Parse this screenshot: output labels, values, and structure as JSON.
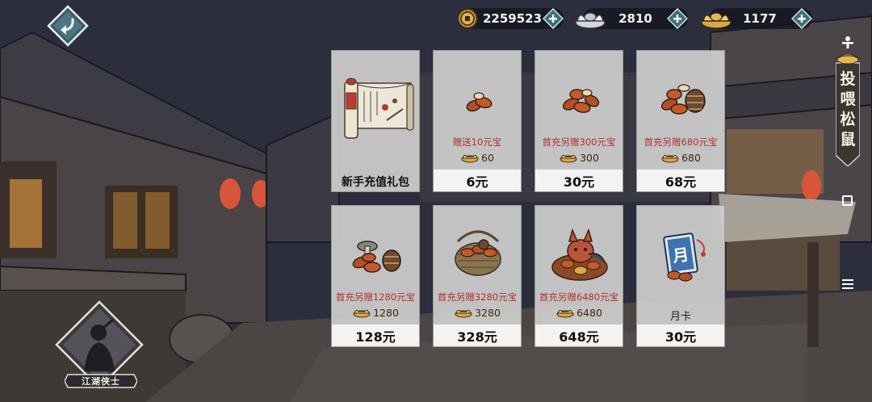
{
  "currencies": [
    {
      "name": "copper-coin",
      "amount": "2259523"
    },
    {
      "name": "silver-ingot",
      "amount": "2810"
    },
    {
      "name": "gold-ingot",
      "amount": "1177"
    }
  ],
  "side_banner": {
    "text": "投喂松鼠"
  },
  "player": {
    "title": "江湖侠士"
  },
  "shop": {
    "items": [
      {
        "id": "starter-pack",
        "title": "新手充值礼包",
        "bonus": "",
        "gold": "",
        "price": ""
      },
      {
        "id": "tier-6",
        "title": "",
        "bonus": "赠送10元宝",
        "gold": "60",
        "price": "6元"
      },
      {
        "id": "tier-30",
        "title": "",
        "bonus": "首充另赠300元宝",
        "gold": "300",
        "price": "30元"
      },
      {
        "id": "tier-68",
        "title": "",
        "bonus": "首充另赠680元宝",
        "gold": "680",
        "price": "68元"
      },
      {
        "id": "tier-128",
        "title": "",
        "bonus": "首充另赠1280元宝",
        "gold": "1280",
        "price": "128元"
      },
      {
        "id": "tier-328",
        "title": "",
        "bonus": "首充另赠3280元宝",
        "gold": "3280",
        "price": "328元"
      },
      {
        "id": "tier-648",
        "title": "",
        "bonus": "首充另赠6480元宝",
        "gold": "6480",
        "price": "648元"
      },
      {
        "id": "monthly-card",
        "title": "月卡",
        "bonus": "",
        "gold": "",
        "price": "30元"
      }
    ],
    "monthly_card_glyph": "月"
  },
  "colors": {
    "bonus_text": "#b23131",
    "card_bg": "#cdcdcd",
    "price_bar": "#f3f3f3",
    "plus_button": "#5fa7b3"
  }
}
